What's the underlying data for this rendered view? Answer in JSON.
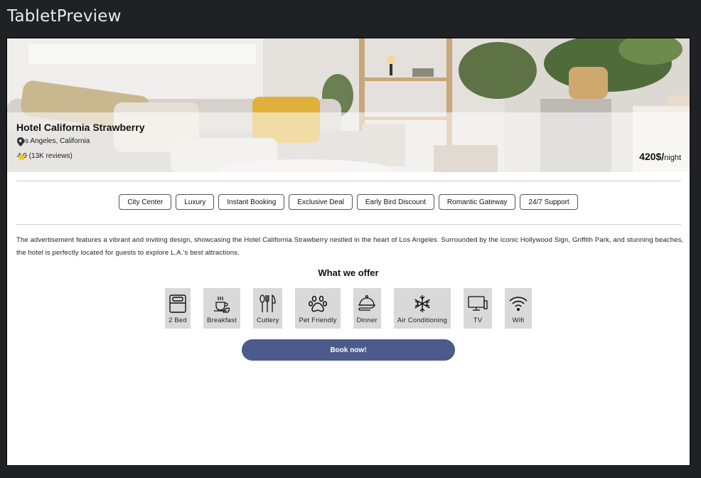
{
  "window": {
    "title": "TabletPreview"
  },
  "hotel": {
    "name": "Hotel California Strawberry",
    "location": "Los Angeles, California",
    "rating": "4.9 (13K reviews)",
    "price": "420$/",
    "price_unit": "night"
  },
  "tags": [
    "City Center",
    "Luxury",
    "Instant Booking",
    "Exclusive Deal",
    "Early Bird Discount",
    "Romantic Gateway",
    "24/7 Support"
  ],
  "description": "The advertisement features a vibrant and inviting design, showcasing the Hotel California Strawberry nestled in the heart of Los Angeles. Surrounded by the iconic Hollywood Sign, Griffith Park, and stunning beaches, the hotel is perfectly located for guests to explore L.A.'s best attractions.",
  "offer": {
    "title": "What we offer",
    "items": [
      {
        "label": "2 Bed",
        "icon": "bed-icon"
      },
      {
        "label": "Breakfast",
        "icon": "breakfast-icon"
      },
      {
        "label": "Cutlery",
        "icon": "cutlery-icon"
      },
      {
        "label": "Pet Friendly",
        "icon": "paw-icon"
      },
      {
        "label": "Dinner",
        "icon": "cloche-icon"
      },
      {
        "label": "Air Conditioning",
        "icon": "snowflake-icon"
      },
      {
        "label": "TV",
        "icon": "tv-icon"
      },
      {
        "label": "Wifi",
        "icon": "wifi-icon"
      }
    ]
  },
  "cta": {
    "label": "Book now!"
  },
  "colors": {
    "primary": "#4a5b8c",
    "tag_border": "#555555",
    "amenity_bg": "#d9d9d9"
  }
}
